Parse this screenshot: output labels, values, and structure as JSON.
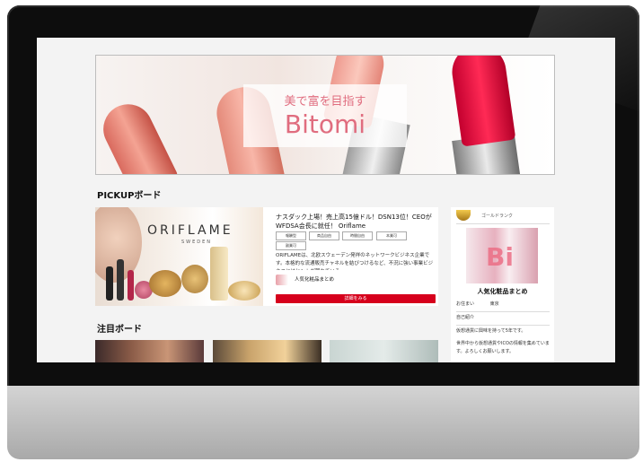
{
  "hero": {
    "subtitle": "美で富を目指す",
    "title": "Bitomi"
  },
  "pickup": {
    "section_title": "PICKUPボード",
    "brand": "ORIFLAME",
    "brand_sub": "SWEDEN",
    "title": "ナスダック上場！売上高15億ドル！DSN13位！CEOがWFDSA会長に就任！ Oriflame",
    "tags": [
      "報酬型",
      "商品自由",
      "時間自由",
      "本業可",
      "副業可"
    ],
    "description": "ORIFLAMEは、北欧スウェーデン発祥のネットワークビジネス企業です。本格的な流通販売チャネルを結びつけるなど、不況に強い事業ビジネスにはヒントが隠れている",
    "author": "人気化粧品まとめ",
    "button": "詳細をみる"
  },
  "profile": {
    "rank": "ゴールドランク",
    "logo": "Bi",
    "name": "人気化粧品まとめ",
    "residence_label": "お住まい",
    "residence_value": "東京",
    "intro_label": "自己紹介",
    "intro_1": "仮想通貨に興味を持って5年です。",
    "intro_2": "世界中から仮想通貨やICOの情報を集めています。よろしくお願いします。"
  },
  "featured": {
    "section_title": "注目ボード"
  }
}
